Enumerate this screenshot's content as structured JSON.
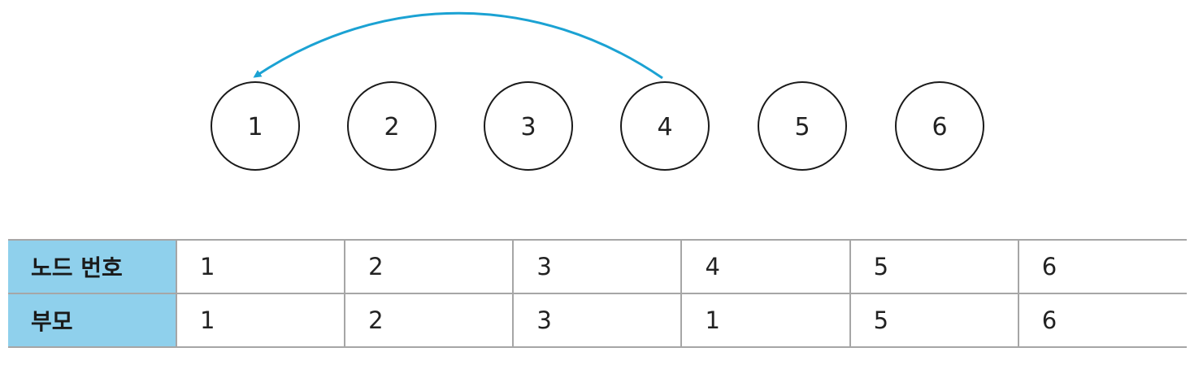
{
  "colors": {
    "edge": "#1ba2d3",
    "header_fill": "#8fd0ec",
    "node_stroke": "#1a1a1a"
  },
  "nodes": [
    {
      "label": "1"
    },
    {
      "label": "2"
    },
    {
      "label": "3"
    },
    {
      "label": "4"
    },
    {
      "label": "5"
    },
    {
      "label": "6"
    }
  ],
  "edges": [
    {
      "from": "4",
      "to": "1"
    }
  ],
  "table": {
    "row_headers": [
      "노드 번호",
      "부모"
    ],
    "node_numbers": [
      "1",
      "2",
      "3",
      "4",
      "5",
      "6"
    ],
    "parents": [
      "1",
      "2",
      "3",
      "1",
      "5",
      "6"
    ]
  }
}
